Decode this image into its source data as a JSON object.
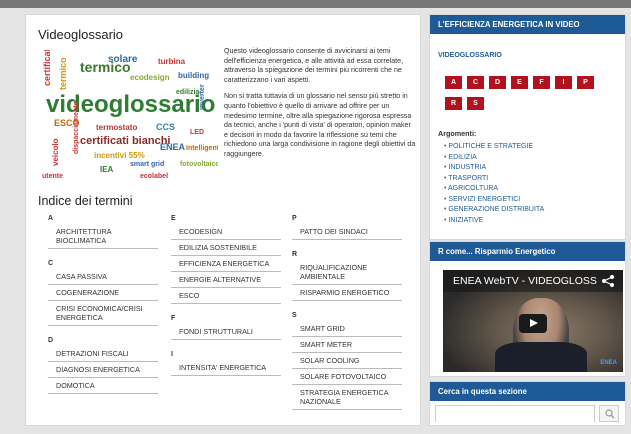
{
  "main": {
    "title": "Videoglossario",
    "description": [
      "Questo videoglossario consente di avvicinarsi ai temi dell'efficienza energetica, e alle attività ad essa correlate, attraverso la spiegazione dei termini più ricorrenti che ne caratterizzano i vari aspetti.",
      "Non si tratta tuttavia di un glossario nel senso più stretto in quanto l'obiettivo è quello di arrivare ad offrire per un medesimo termine, oltre alla spiegazione rigorosa espressa da tecnici, anche i 'punti di vista' di operatori, opinion maker e decisori in modo da favorire la riflessione su temi che richiedono una larga condivisione in ragione degli obiettivi da raggiungere."
    ],
    "cloud_words": [
      "videoglossario",
      "certificati bianchi",
      "termico",
      "solare",
      "ciclo",
      "energetica",
      "ESCO",
      "termostato",
      "LED",
      "CCS",
      "ENEA",
      "incentivi 55%",
      "veicolo",
      "dispacciamento",
      "utente",
      "inverter",
      "building",
      "edilizia",
      "IEA",
      "ecolabel",
      "smart grid",
      "Intelligent",
      "turbina",
      "ecodesign",
      "fotovoltaico"
    ],
    "index_title": "Indice dei termini",
    "columns": [
      [
        {
          "letter": "A",
          "terms": [
            "ARCHITETTURA BIOCLIMATICA"
          ]
        },
        {
          "letter": "C",
          "terms": [
            "CASA PASSIVA",
            "COGENERAZIONE",
            "CRISI ECONOMICA/CRISI ENERGETICA"
          ]
        },
        {
          "letter": "D",
          "terms": [
            "DETRAZIONI FISCALI",
            "DIAGNOSI ENERGETICA",
            "DOMOTICA"
          ]
        }
      ],
      [
        {
          "letter": "E",
          "terms": [
            "ECODESIGN",
            "EDILIZIA SOSTENIBILE",
            "EFFICIENZA ENERGETICA",
            "ENERGIE ALTERNATIVE",
            "ESCO"
          ]
        },
        {
          "letter": "F",
          "terms": [
            "FONDI STRUTTURALI"
          ]
        },
        {
          "letter": "I",
          "terms": [
            "INTENSITA' ENERGETICA"
          ]
        }
      ],
      [
        {
          "letter": "P",
          "terms": [
            "PATTO DEI SINDACI"
          ]
        },
        {
          "letter": "R",
          "terms": [
            "RIQUALIFICAZIONE AMBIENTALE",
            "RISPARMIO ENERGETICO"
          ]
        },
        {
          "letter": "S",
          "terms": [
            "SMART GRID",
            "SMART METER",
            "SOLAR COOLING",
            "SOLARE FOTOVOLTAICO",
            "STRATEGIA ENERGETICA NAZIONALE"
          ]
        }
      ]
    ]
  },
  "sidebar": {
    "box1": {
      "header": "L'EFFICIENZA ENERGETICA IN VIDEO",
      "subtitle": "VIDEOGLOSSARIO",
      "letters": [
        "A",
        "C",
        "D",
        "E",
        "F",
        "I",
        "P",
        "R",
        "S"
      ],
      "args_label": "Argomenti:",
      "args": [
        "POLITICHE E STRATEGIE",
        "EDILIZIA",
        "INDUSTRIA",
        "TRASPORTI",
        "AGRICOLTURA",
        "SERVIZI ENERGETICI",
        "GENERAZIONE DISTRIBUITA",
        "INIZIATIVE"
      ]
    },
    "box2": {
      "header": "R come... Risparmio Energetico",
      "video_title": "ENEA WebTV - VIDEOGLOSS",
      "badge": "ENEA"
    },
    "box3": {
      "header": "Cerca in questa sezione",
      "search_placeholder": ""
    }
  },
  "colors": {
    "accent": "#1e5a96",
    "letter_button": "#b2121d"
  }
}
